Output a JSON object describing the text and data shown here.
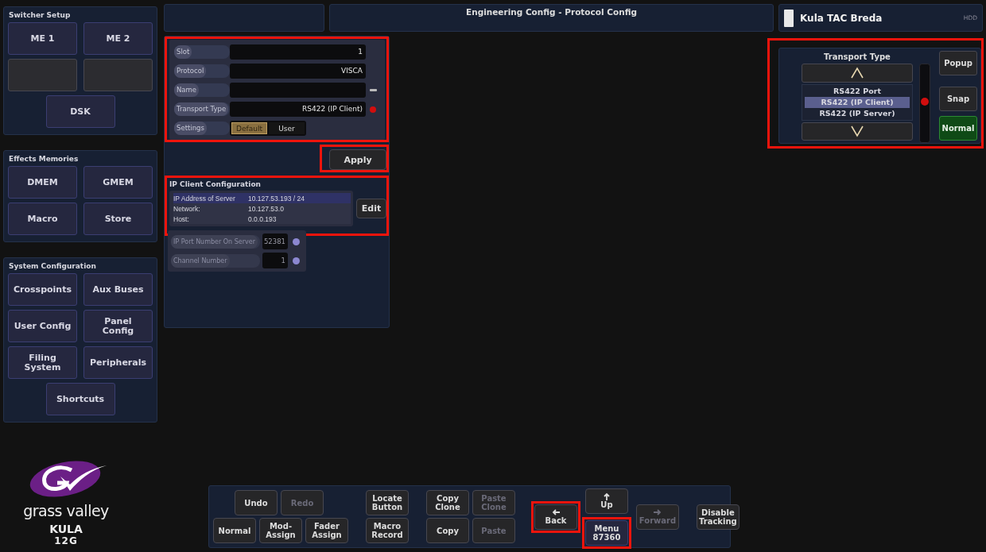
{
  "sidebar": {
    "sections": [
      {
        "title": "Switcher Setup",
        "buttons": [
          {
            "kind": "button",
            "label": "ME 1"
          },
          {
            "kind": "button",
            "label": "ME 2"
          },
          {
            "kind": "blank"
          },
          {
            "kind": "blank"
          },
          {
            "kind": "button",
            "label": "DSK"
          }
        ]
      },
      {
        "title": "Effects Memories",
        "buttons": [
          {
            "kind": "button",
            "label": "DMEM"
          },
          {
            "kind": "button",
            "label": "GMEM"
          },
          {
            "kind": "button",
            "label": "Macro"
          },
          {
            "kind": "button",
            "label": "Store"
          }
        ]
      },
      {
        "title": "System Configuration",
        "buttons": [
          {
            "kind": "button",
            "label": "Crosspoints"
          },
          {
            "kind": "button",
            "label": "Aux Buses"
          },
          {
            "kind": "button",
            "label": "User Config"
          },
          {
            "kind": "button",
            "label": "Panel Config"
          },
          {
            "kind": "button",
            "label": "Filing System"
          },
          {
            "kind": "button",
            "label": "Peripherals"
          },
          {
            "kind": "button",
            "label": "Shortcuts"
          }
        ]
      }
    ]
  },
  "logo": {
    "brand": "grass valley",
    "product": "KULA",
    "model": "12G"
  },
  "header": {
    "title": "Engineering Config - Protocol Config",
    "device": "Kula TAC Breda",
    "storage": "HDD"
  },
  "protocol_form": {
    "highlighted": true,
    "fields": [
      {
        "kind": "plain",
        "label": "Slot",
        "value": "1"
      },
      {
        "kind": "plain",
        "label": "Protocol",
        "value": "VISCA"
      },
      {
        "kind": "dashed",
        "label": "Name"
      },
      {
        "kind": "alert",
        "label": "Transport Type",
        "value": "RS422 (IP Client)"
      }
    ],
    "settings": {
      "label": "Settings",
      "options": [
        {
          "label": "Default",
          "selected": true
        },
        {
          "label": "User",
          "selected": false
        }
      ]
    }
  },
  "apply_button": {
    "label": "Apply",
    "highlighted": true
  },
  "ip_client": {
    "title": "IP Client Configuration",
    "highlighted": true,
    "edit_button": "Edit",
    "rows": [
      {
        "label": "IP Address of Server",
        "value": "10.127.53.193 / 24",
        "selected": true
      },
      {
        "label": "Network:",
        "value": "10.127.53.0",
        "selected": false
      },
      {
        "label": "Host:",
        "value": "0.0.0.193",
        "selected": false
      }
    ]
  },
  "port_fields": [
    {
      "label": "IP Port Number On Server",
      "value": "52381",
      "disabled": true
    },
    {
      "label": "Channel Number",
      "value": "1",
      "disabled": true
    }
  ],
  "transport_type": {
    "title": "Transport Type",
    "highlighted": true,
    "options": [
      {
        "label": "RS422 Port",
        "selected": false
      },
      {
        "label": "RS422 (IP Client)",
        "selected": true
      },
      {
        "label": "RS422 (IP Server)",
        "selected": false
      }
    ],
    "buttons": [
      {
        "label": "Popup",
        "selected": false
      },
      {
        "label": "Snap",
        "selected": false
      },
      {
        "label": "Normal",
        "selected": true
      }
    ]
  },
  "toolbar": {
    "groups": [
      {
        "rows": [
          [
            {
              "kind": "spacer"
            },
            {
              "kind": "button",
              "label": "Undo",
              "disabled": false
            },
            {
              "kind": "button",
              "label": "Redo",
              "disabled": true
            }
          ],
          [
            {
              "kind": "button",
              "label": "Normal",
              "disabled": false
            },
            {
              "kind": "button",
              "label": "Mod-Assign",
              "disabled": false
            },
            {
              "kind": "button",
              "label": "Fader Assign",
              "disabled": false
            }
          ]
        ]
      },
      {
        "rows": [
          [
            {
              "kind": "button",
              "label": "Locate Button",
              "disabled": false
            }
          ],
          [
            {
              "kind": "button",
              "label": "Macro Record",
              "disabled": false
            }
          ]
        ]
      },
      {
        "rows": [
          [
            {
              "kind": "button",
              "label": "Copy Clone",
              "disabled": false
            },
            {
              "kind": "button",
              "label": "Paste Clone",
              "disabled": true
            }
          ],
          [
            {
              "kind": "button",
              "label": "Copy",
              "disabled": false
            },
            {
              "kind": "button",
              "label": "Paste",
              "disabled": true
            }
          ]
        ]
      }
    ],
    "navigation": [
      {
        "kind": "back",
        "label": "Back",
        "disabled": false,
        "highlighted": true
      },
      {
        "kind": "up",
        "label": "Up",
        "disabled": false,
        "highlighted": false
      },
      {
        "kind": "menu",
        "label": "Menu 87360",
        "disabled": false,
        "highlighted": true
      },
      {
        "kind": "forward",
        "label": "Forward",
        "disabled": true,
        "highlighted": false
      }
    ],
    "tracking_button": {
      "label": "Disable Tracking",
      "disabled": false
    }
  }
}
